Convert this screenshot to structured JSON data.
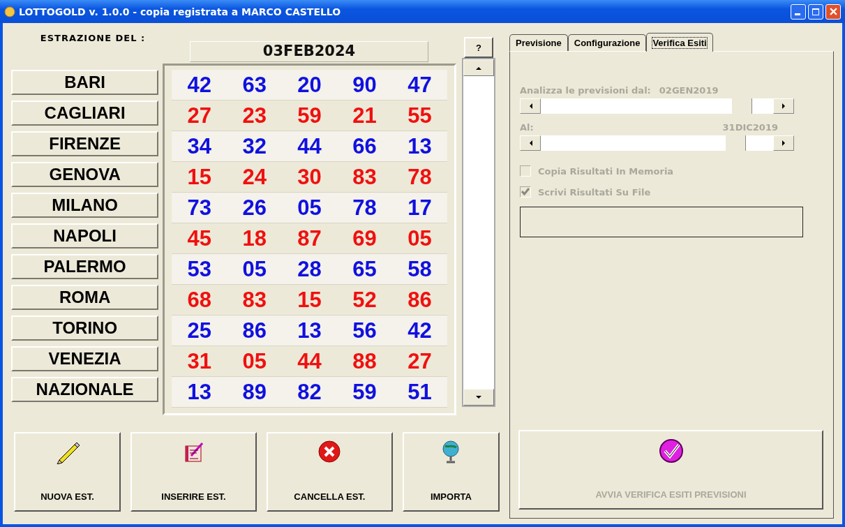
{
  "window": {
    "title": "LOTTOGOLD v. 1.0.0 - copia registrata a MARCO CASTELLO"
  },
  "draw_date": {
    "label": "ESTRAZIONE DEL :",
    "value": "03FEB2024"
  },
  "help_button": "?",
  "wheels": [
    {
      "city": "BARI",
      "color": "#1010e0",
      "numbers": [
        "42",
        "63",
        "20",
        "90",
        "47"
      ]
    },
    {
      "city": "CAGLIARI",
      "color": "#f01010",
      "numbers": [
        "27",
        "23",
        "59",
        "21",
        "55"
      ]
    },
    {
      "city": "FIRENZE",
      "color": "#1010e0",
      "numbers": [
        "34",
        "32",
        "44",
        "66",
        "13"
      ]
    },
    {
      "city": "GENOVA",
      "color": "#f01010",
      "numbers": [
        "15",
        "24",
        "30",
        "83",
        "78"
      ]
    },
    {
      "city": "MILANO",
      "color": "#1010e0",
      "numbers": [
        "73",
        "26",
        "05",
        "78",
        "17"
      ]
    },
    {
      "city": "NAPOLI",
      "color": "#f01010",
      "numbers": [
        "45",
        "18",
        "87",
        "69",
        "05"
      ]
    },
    {
      "city": "PALERMO",
      "color": "#1010e0",
      "numbers": [
        "53",
        "05",
        "28",
        "65",
        "58"
      ]
    },
    {
      "city": "ROMA",
      "color": "#f01010",
      "numbers": [
        "68",
        "83",
        "15",
        "52",
        "86"
      ]
    },
    {
      "city": "TORINO",
      "color": "#1010e0",
      "numbers": [
        "25",
        "86",
        "13",
        "56",
        "42"
      ]
    },
    {
      "city": "VENEZIA",
      "color": "#f01010",
      "numbers": [
        "31",
        "05",
        "44",
        "88",
        "27"
      ]
    },
    {
      "city": "NAZIONALE",
      "color": "#1010e0",
      "numbers": [
        "13",
        "89",
        "82",
        "59",
        "51"
      ]
    }
  ],
  "buttons": [
    {
      "label": "NUOVA EST.",
      "kind": "pencil"
    },
    {
      "label": "INSERIRE EST.",
      "kind": "notebook"
    },
    {
      "label": "CANCELLA EST.",
      "kind": "cancel"
    },
    {
      "label": "IMPORTA",
      "kind": "globe"
    }
  ],
  "tabs": [
    {
      "label": "Previsione",
      "selected": false
    },
    {
      "label": "Configurazione",
      "selected": false
    },
    {
      "label": "Verifica Esiti",
      "selected": true
    }
  ],
  "verify": {
    "from_label": "Analizza le previsioni dal:",
    "from_value": "02GEN2019",
    "from_slider": {
      "level": 0.9
    },
    "to_label": "Al:",
    "to_value": "31DIC2019",
    "to_slider": {
      "level": 0.87
    },
    "options": [
      {
        "label": "Copia Risultati In Memoria",
        "checked": false,
        "disabled": true
      },
      {
        "label": "Scrivi Risultati Su File",
        "checked": true,
        "disabled": true
      }
    ],
    "run_button": {
      "label": "AVVIA VERIFICA ESITI PREVISIONI",
      "disabled": true
    }
  }
}
